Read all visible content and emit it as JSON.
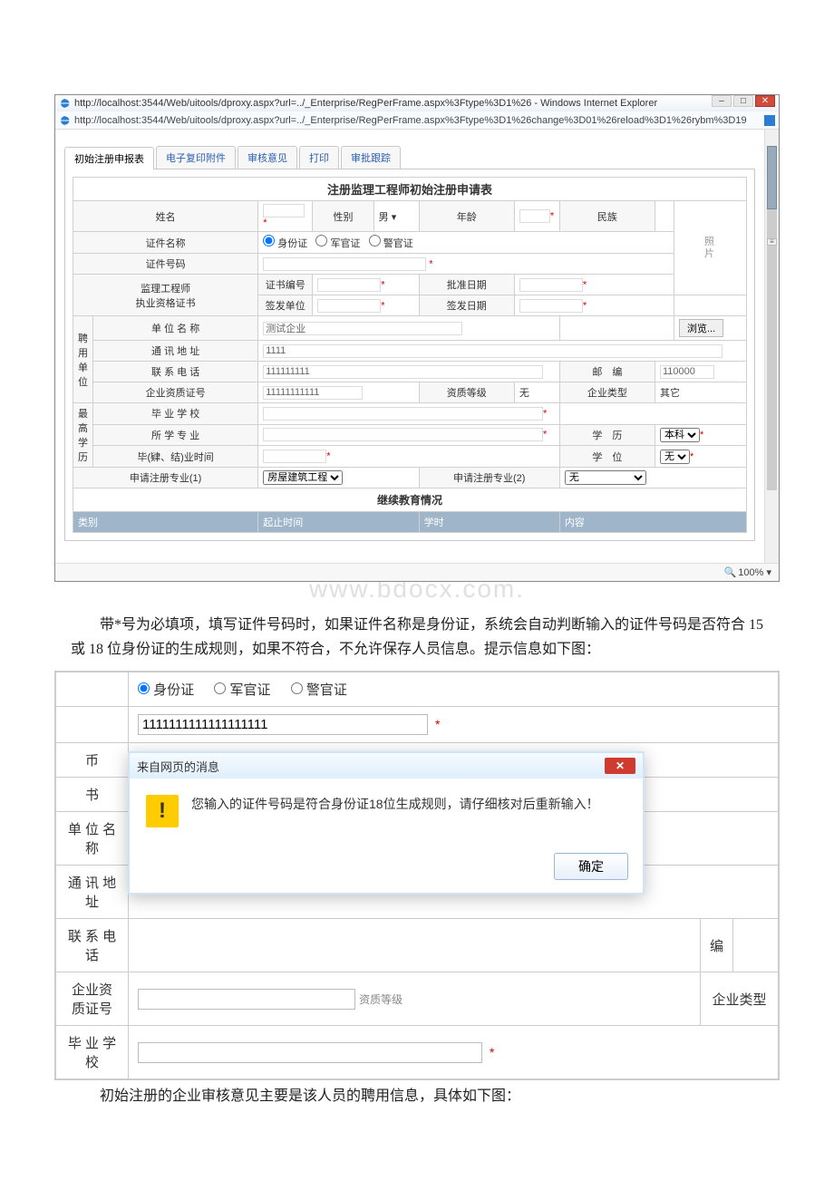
{
  "ie": {
    "title": "http://localhost:3544/Web/uitools/dproxy.aspx?url=../_Enterprise/RegPerFrame.aspx%3Ftype%3D1%26 - Windows Internet Explorer",
    "address": "http://localhost:3544/Web/uitools/dproxy.aspx?url=../_Enterprise/RegPerFrame.aspx%3Ftype%3D1%26change%3D01%26reload%3D1%26rybm%3D19",
    "zoom": "100%"
  },
  "tabs": {
    "items": [
      "初始注册申报表",
      "电子复印附件",
      "审核意见",
      "打印",
      "审批跟踪"
    ]
  },
  "form": {
    "title": "注册监理工程师初始注册申请表",
    "labels": {
      "name": "姓名",
      "gender": "性别",
      "gender_val": "男",
      "age": "年龄",
      "nation": "民族",
      "photo": "照\n片",
      "doc_name": "证件名称",
      "doc_id": "证件号码",
      "id_type1": "身份证",
      "id_type2": "军官证",
      "id_type3": "警官证",
      "cert": "监理工程师\n执业资格证书",
      "cert_no": "证书编号",
      "approve_date": "批准日期",
      "issue_org": "签发单位",
      "issue_date": "签发日期",
      "employ": "聘\n用\n单\n位",
      "unit_name": "单 位 名 称",
      "unit_name_val": "测试企业",
      "browse": "浏览...",
      "addr": "通 讯 地 址",
      "addr_val": "1111",
      "tel": "联 系 电 话",
      "tel_val": "111111111",
      "zip": "邮　编",
      "zip_val": "110000",
      "qual_no": "企业资质证号",
      "qual_no_val": "11111111111",
      "qual_lvl": "资质等级",
      "qual_lvl_val": "无",
      "ent_type": "企业类型",
      "ent_type_val": "其它",
      "edu": "最\n高\n学\n历",
      "school": "毕 业 学 校",
      "major": "所 学 专 业",
      "degree": "学　历",
      "degree_val": "本科",
      "degree2": "学　位",
      "degree2_val": "无",
      "grad_date": "毕(肄、结)业时间",
      "apply1": "申请注册专业(1)",
      "apply1_val": "房屋建筑工程",
      "apply2": "申请注册专业(2)",
      "apply2_val": "无",
      "edu_cont": "继续教育情况",
      "cols": [
        "类别",
        "起止时间",
        "学时",
        "内容"
      ]
    }
  },
  "watermark": "www.bdocx.com.",
  "para1": "带*号为必填项，填写证件号码时，如果证件名称是身份证，系统会自动判断输入的证件号码是否符合 15 或 18 位身份证的生成规则，如果不符合，不允许保存人员信息。提示信息如下图：",
  "ss2": {
    "id_type1": "身份证",
    "id_type2": "军官证",
    "id_type3": "警官证",
    "id_val": "1111111111111111111",
    "row1": "币",
    "row2": "书",
    "row3": "单 位 名 称",
    "row4": "通 讯 地 址",
    "row5": "联 系 电 话",
    "row6": "企业资质证号",
    "row7": "毕 业 学 校",
    "qual_lvl": "资质等级",
    "ent_type": "企业类型",
    "zip": "编",
    "dlg_title": "来自网页的消息",
    "dlg_msg": "您输入的证件号码是符合身份证18位生成规则，请仔细核对后重新输入！",
    "dlg_ok": "确定"
  },
  "para2": "初始注册的企业审核意见主要是该人员的聘用信息，具体如下图："
}
